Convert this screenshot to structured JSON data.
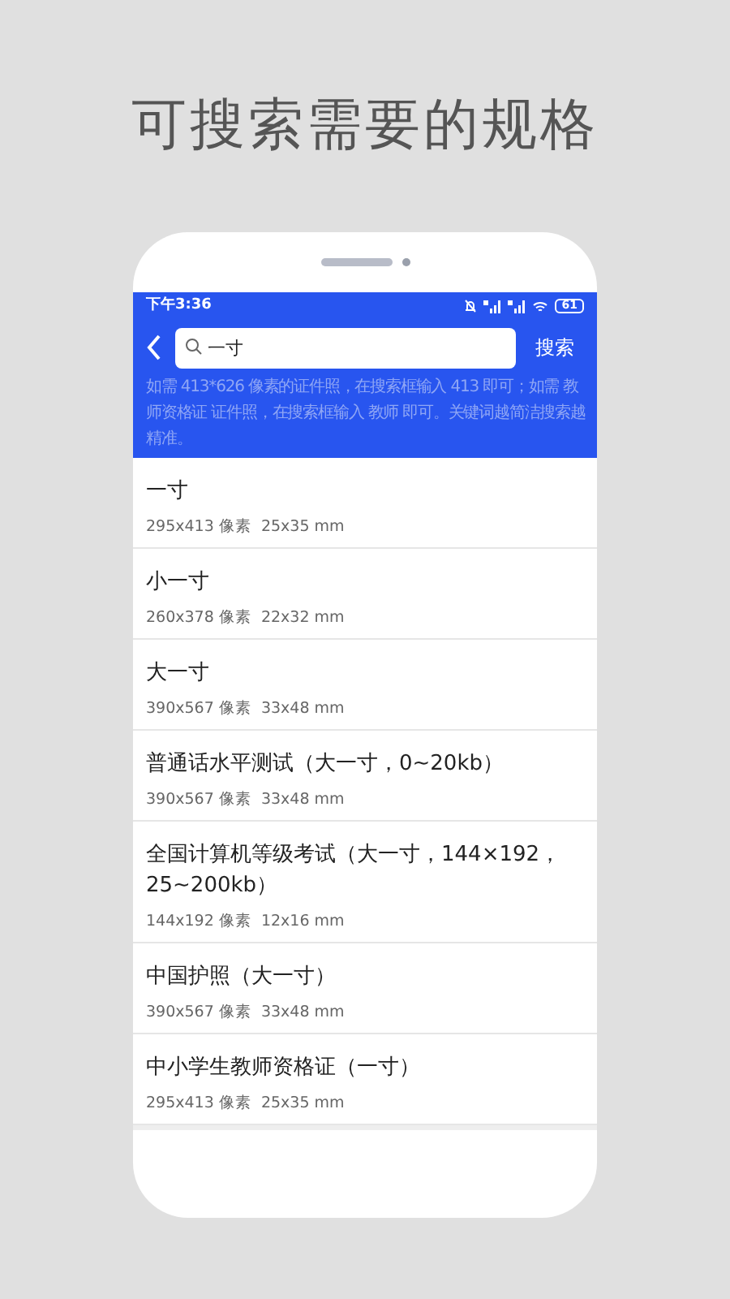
{
  "headline": "可搜索需要的规格",
  "status_bar": {
    "time": "下午3:36",
    "battery": "61"
  },
  "search": {
    "value": "一寸",
    "button": "搜索"
  },
  "hint": "如需 413*626 像素的证件照，在搜索框输入 413 即可；如需 教师资格证 证件照，在搜索框输入 教师 即可。关键词越简洁搜索越精准。",
  "results": [
    {
      "title": "一寸",
      "spec": "295x413 像素  25x35 mm"
    },
    {
      "title": "小一寸",
      "spec": "260x378 像素  22x32 mm"
    },
    {
      "title": "大一寸",
      "spec": "390x567 像素  33x48 mm"
    },
    {
      "title": "普通话水平测试（大一寸，0~20kb）",
      "spec": "390x567 像素  33x48 mm"
    },
    {
      "title": "全国计算机等级考试（大一寸，144×192，25~200kb）",
      "spec": "144x192 像素  12x16 mm"
    },
    {
      "title": "中国护照（大一寸）",
      "spec": "390x567 像素  33x48 mm"
    },
    {
      "title": "中小学生教师资格证（一寸）",
      "spec": "295x413 像素  25x35 mm"
    }
  ]
}
